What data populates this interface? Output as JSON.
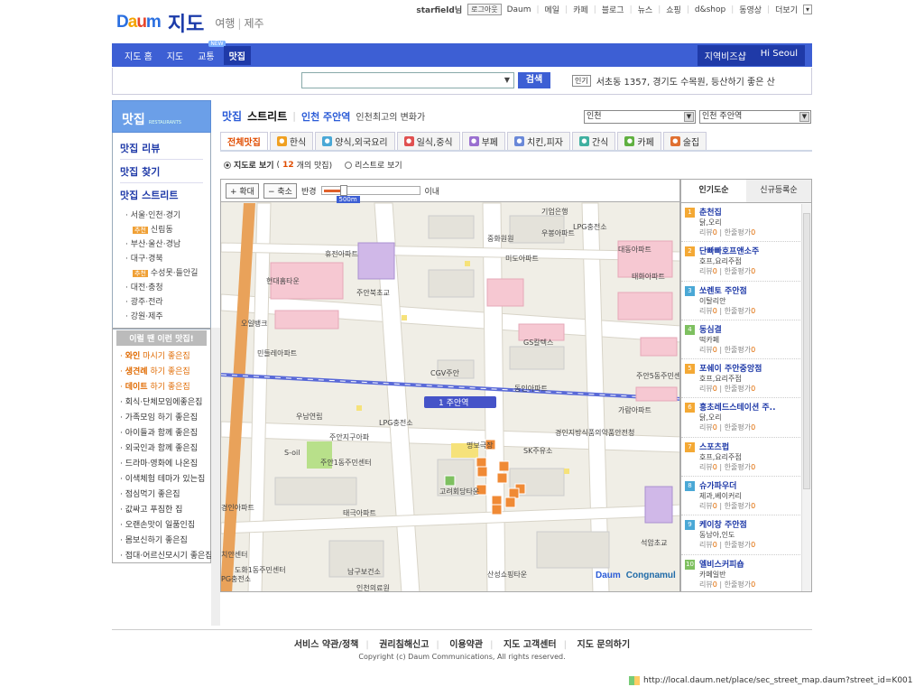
{
  "brand": {
    "logo_letters": [
      "D",
      "a",
      "u",
      "m"
    ],
    "service": "지도",
    "subnav": [
      "여행",
      "제주"
    ]
  },
  "gnb": {
    "user": "starfield님",
    "logout": "로그아웃",
    "links": [
      "Daum",
      "메일",
      "카페",
      "블로그",
      "뉴스",
      "쇼핑",
      "d&shop",
      "동영상",
      "더보기"
    ]
  },
  "nav": {
    "items": [
      "지도 홈",
      "지도",
      "교통",
      "맛집"
    ],
    "new_badge": "NEW",
    "right": [
      "지역비즈샵",
      "Hi Seoul"
    ]
  },
  "search": {
    "value": "",
    "button": "검색",
    "hot_label": "인기",
    "hot_text": "서초동 1357, 경기도 수목원, 등산하기 좋은 산"
  },
  "side": {
    "title": "맛집",
    "title_en": "RESTAURANTS",
    "menu": [
      "맛집 리뷰",
      "맛집 찾기",
      "맛집 스트리트"
    ],
    "regions": [
      "서울·인천·경기",
      "신림동",
      "부산·울산·경남",
      "대구·경북",
      "수성못·들안길",
      "대전·충청",
      "광주·전라",
      "강원·제주"
    ],
    "tag": "추천"
  },
  "side2": {
    "title": "이럴 땐 이런 맛집!",
    "items": [
      {
        "b": "와인",
        "t": " 마시기 좋은집"
      },
      {
        "b": "생견례",
        "t": " 하기 좋은집"
      },
      {
        "b": "데이트",
        "t": " 하기 좋은집"
      },
      {
        "b": "",
        "t": "회식·단체모임에좋은집"
      },
      {
        "b": "",
        "t": "가족모임 하기 좋은집"
      },
      {
        "b": "",
        "t": "아이들과 함께 좋은집"
      },
      {
        "b": "",
        "t": "외국인과 함께 좋은집"
      },
      {
        "b": "",
        "t": "드라마·영화에 나온집"
      },
      {
        "b": "",
        "t": "이색체험 테마가 있는집"
      },
      {
        "b": "",
        "t": "점심먹기 좋은집"
      },
      {
        "b": "",
        "t": "값싸고 푸짐한 집"
      },
      {
        "b": "",
        "t": "오랜손맛이 일품인집"
      },
      {
        "b": "",
        "t": "몸보신하기 좋은집"
      },
      {
        "b": "",
        "t": "접대·어르신모시기 좋은집"
      }
    ]
  },
  "page": {
    "t1": "맛집",
    "t2": "스트리트",
    "t3": "인천 주안역",
    "t4": "인천최고의 변화가",
    "sel1": "인천",
    "sel2": "인천 주안역"
  },
  "tabs": [
    {
      "label": "전체맛집",
      "icon": ""
    },
    {
      "label": "한식",
      "icon": "bowl-icon",
      "color": "#f0a020"
    },
    {
      "label": "양식,외국요리",
      "icon": "fork-icon",
      "color": "#4aa8d6"
    },
    {
      "label": "일식,중식",
      "icon": "sushi-icon",
      "color": "#e05050"
    },
    {
      "label": "부페",
      "icon": "buffet-icon",
      "color": "#9a70d0"
    },
    {
      "label": "치킨,피자",
      "icon": "chicken-icon",
      "color": "#6a88d8"
    },
    {
      "label": "간식",
      "icon": "snack-icon",
      "color": "#40b0a0"
    },
    {
      "label": "카페",
      "icon": "cup-icon",
      "color": "#60b040"
    },
    {
      "label": "술집",
      "icon": "beer-icon",
      "color": "#e07030"
    }
  ],
  "view": {
    "map_label": "지도로 보기",
    "count": "12",
    "count_pre": " (",
    "count_post": "개의 맛집)",
    "list_label": "리스트로 보기"
  },
  "maptool": {
    "zoom_in": "+ 확대",
    "zoom_out": "− 축소",
    "radius": "반경",
    "scale": "500m",
    "within": "이내"
  },
  "map": {
    "labels": [
      "기업은행",
      "LPG충전소",
      "중화원원",
      "우봉아파트",
      "대동아파트",
      "휴전아파트",
      "미도아파트",
      "태화아파트",
      "현대홈타운",
      "주안북초교",
      "오일뱅크",
      "민들레아파트",
      "GS칼텍스",
      "주안5동주민센터",
      "CGV주안",
      "동인아파트",
      "1 주안역",
      "가람아파트",
      "우남연립",
      "LPG충전소",
      "주안지구아파",
      "경인지방식품의약품안전청",
      "명보극장",
      "SK주유소",
      "S-oil",
      "주안1동주민센터",
      "고려회당타운",
      "경인아파트",
      "태극아파트",
      "석암초교",
      "치안센터",
      "도화1동주민센터",
      "남구보건소",
      "산성쇼핑타운",
      "PG충전소",
      "인천의료원"
    ],
    "logo1": "Daum",
    "logo2": "Congnamul"
  },
  "rlist": {
    "tabs": [
      "인기도순",
      "신규등록순"
    ],
    "review_label": "리뷰",
    "rating_label": "한줄평가",
    "items": [
      {
        "n": "1",
        "name": "춘천집",
        "cat": "닭,오리",
        "r": "0",
        "c": "0"
      },
      {
        "n": "2",
        "name": "단빠빠호프앤소주",
        "cat": "호프,요리주점",
        "r": "0",
        "c": "0"
      },
      {
        "n": "3",
        "name": "쏘렌토 주안점",
        "cat": "이탈리안",
        "r": "0",
        "c": "0"
      },
      {
        "n": "4",
        "name": "동심결",
        "cat": "떡카페",
        "r": "0",
        "c": "0"
      },
      {
        "n": "5",
        "name": "포쉐이 주안중앙점",
        "cat": "호프,요리주점",
        "r": "0",
        "c": "0"
      },
      {
        "n": "6",
        "name": "홍초레드스테이션 주..",
        "cat": "닭,오리",
        "r": "0",
        "c": "0"
      },
      {
        "n": "7",
        "name": "스포츠펍",
        "cat": "호프,요리주점",
        "r": "0",
        "c": "0"
      },
      {
        "n": "8",
        "name": "슈가파우더",
        "cat": "제과,베이커리",
        "r": "0",
        "c": "0"
      },
      {
        "n": "9",
        "name": "케이창 주안점",
        "cat": "동남아,인도",
        "r": "0",
        "c": "0"
      },
      {
        "n": "10",
        "name": "엘비스커피숍",
        "cat": "카페일반",
        "r": "0",
        "c": "0"
      }
    ]
  },
  "footer": {
    "links": [
      "서비스 약관/정책",
      "권리침해신고",
      "이용약관",
      "지도 고객센터",
      "지도 문의하기"
    ],
    "copy": "Copyright (c) Daum Communications, All rights reserved."
  },
  "status": {
    "url": "http://local.daum.net/place/sec_street_map.daum?street_id=K001"
  }
}
